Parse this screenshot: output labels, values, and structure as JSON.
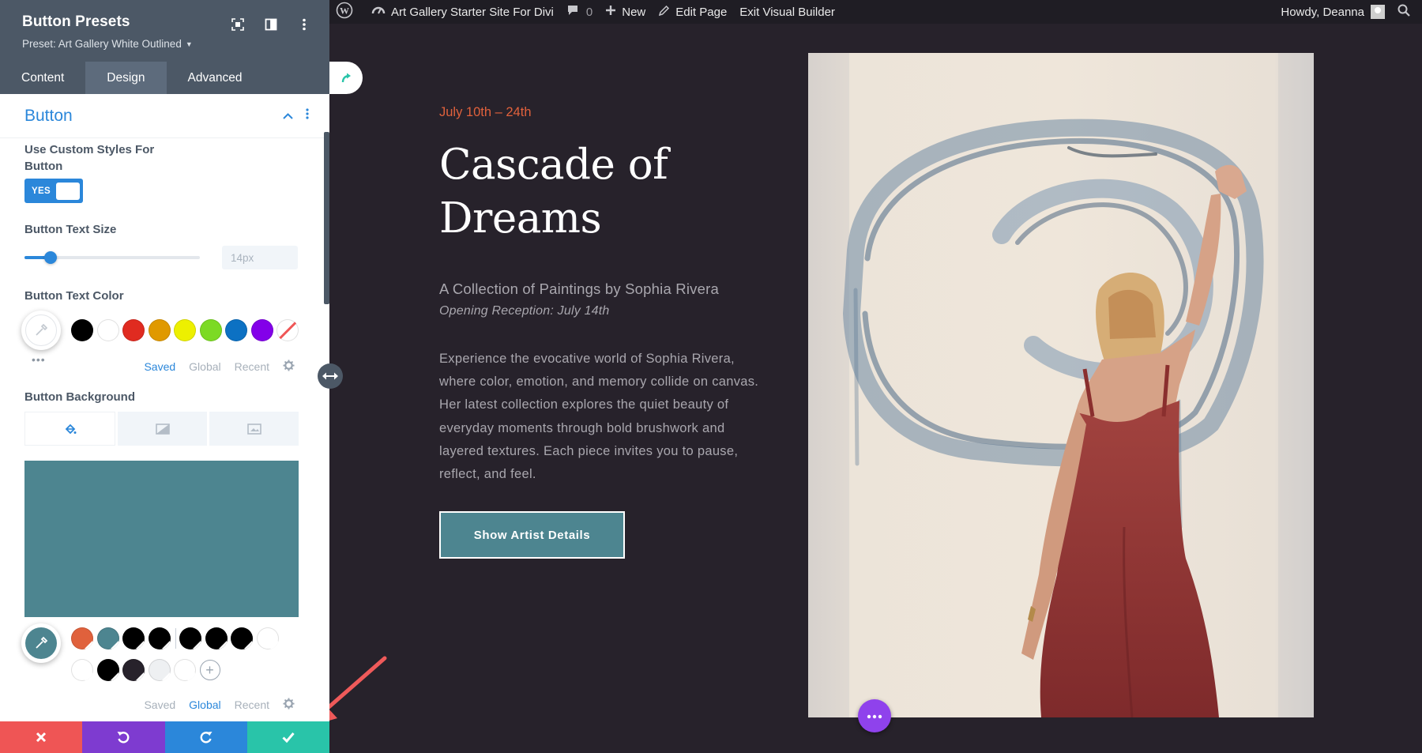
{
  "admin_bar": {
    "site_name": "Art Gallery Starter Site For Divi",
    "comments_count": "0",
    "new_label": "New",
    "edit_page_label": "Edit Page",
    "exit_builder_label": "Exit Visual Builder",
    "greeting": "Howdy, Deanna"
  },
  "panel": {
    "title": "Button Presets",
    "preset": "Preset: Art Gallery White Outlined",
    "tabs": [
      "Content",
      "Design",
      "Advanced"
    ],
    "active_tab": "Design",
    "section_title": "Button",
    "custom_styles_label": "Use Custom Styles For Button",
    "toggle_label": "YES",
    "text_size_label": "Button Text Size",
    "text_size_placeholder": "14px",
    "text_size_slider_fraction": 0.15,
    "text_color_label": "Button Text Color",
    "text_color_swatches": [
      "#000000",
      "#ffffff",
      "#e02b20",
      "#e09900",
      "#edf000",
      "#7cda24",
      "#0c71c3",
      "#8300e9",
      "none"
    ],
    "text_color_footer": [
      "Saved",
      "Global",
      "Recent"
    ],
    "text_color_footer_active": "Saved",
    "background_label": "Button Background",
    "background_color": "#4d8590",
    "bg_swatches_row1": [
      "#e0613c",
      "#4d8590",
      "#000000",
      "#000000",
      "|",
      "#000000",
      "#000000",
      "#000000",
      "#ffffff"
    ],
    "bg_swatches_row2": [
      "#ffffff",
      "#000000",
      "#27222b",
      "#eef0f2",
      "#ffffff"
    ],
    "bg_footer": [
      "Saved",
      "Global",
      "Recent"
    ],
    "bg_footer_active": "Global"
  },
  "page": {
    "date": "July 10th – 24th",
    "title": "Cascade of Dreams",
    "subtitle": "A Collection of Paintings by Sophia Rivera",
    "reception": "Opening Reception: July 14th",
    "description": "Experience the evocative world of Sophia Rivera, where color, emotion, and memory collide on canvas. Her latest collection explores the quiet beauty of everyday moments through bold brushwork and layered textures. Each piece invites you to pause, reflect, and feel.",
    "button_label": "Show Artist Details"
  },
  "colors": {
    "accent_blue": "#2b87da",
    "panel_header": "#4c5866",
    "cancel": "#ef5555",
    "undo": "#7e3bd0",
    "redo": "#2b87da",
    "save": "#29c4a9",
    "canvas_bg": "#27222b",
    "date_orange": "#e0613c",
    "teal": "#4d8590"
  }
}
